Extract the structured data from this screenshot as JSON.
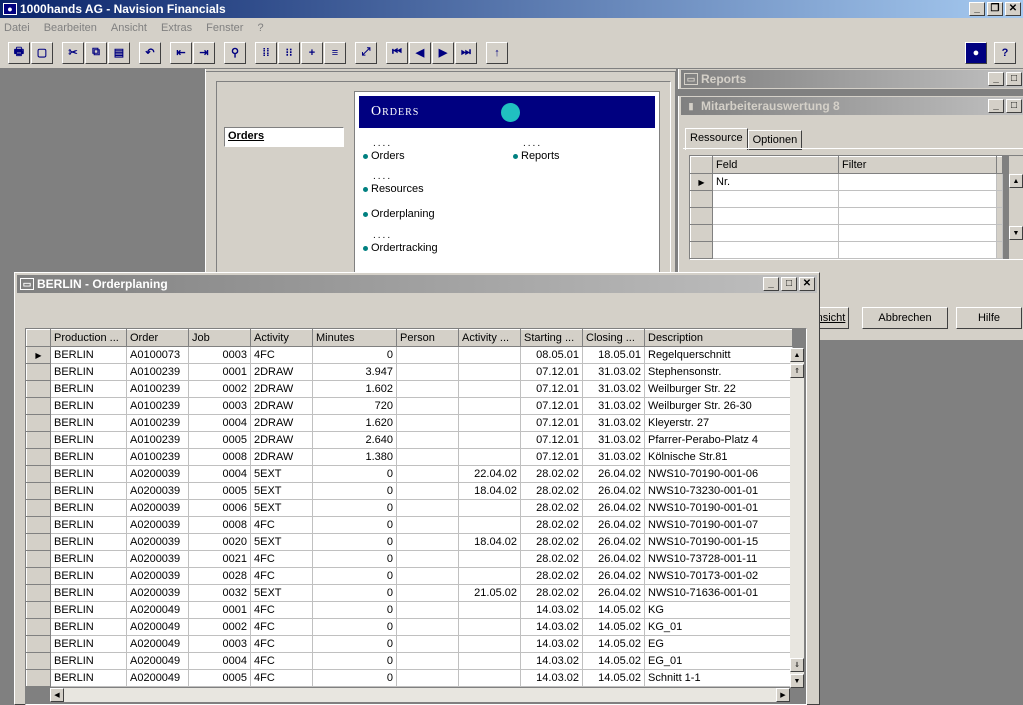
{
  "app": {
    "title": "1000hands AG - Navision Financials"
  },
  "menu": [
    "Datei",
    "Bearbeiten",
    "Ansicht",
    "Extras",
    "Fenster",
    "?"
  ],
  "toolbar": {
    "icons": [
      "print-icon",
      "print-preview-icon",
      "cut-icon",
      "copy-icon",
      "paste-icon",
      "undo-icon",
      "indent-left-icon",
      "indent-right-icon",
      "find-icon",
      "list-view-icon",
      "card-view-icon",
      "insert-icon",
      "filter-icon",
      "zoom-icon",
      "first-record-icon",
      "previous-record-icon",
      "next-record-icon",
      "last-record-icon",
      "up-icon",
      "navigator-icon",
      "help-icon"
    ]
  },
  "navigator": {
    "tab": "Orders",
    "menu_title": "Orders",
    "items": [
      {
        "label": "Orders"
      },
      {
        "label": "Reports"
      },
      {
        "label": "Resources"
      },
      {
        "label": "Orderplaning"
      },
      {
        "label": "Ordertracking"
      }
    ],
    "dots": "...."
  },
  "reports": {
    "title": "Reports"
  },
  "mitarbeiter": {
    "title": "Mitarbeiterauswertung 8",
    "tabs": [
      "Ressource",
      "Optionen"
    ],
    "columns": [
      "Feld",
      "Filter"
    ],
    "rows": [
      [
        "Nr.",
        ""
      ],
      [
        "",
        ""
      ],
      [
        "",
        ""
      ],
      [
        "",
        ""
      ],
      [
        "",
        ""
      ]
    ],
    "buttons": {
      "view": "Ansicht",
      "view_partial": "nsicht",
      "cancel": "Abbrechen",
      "help": "Hilfe"
    }
  },
  "orderplaning": {
    "title": "BERLIN - Orderplaning",
    "columns": [
      "Production ...",
      "Order",
      "Job",
      "Activity",
      "Minutes",
      "Person",
      "Activity ...",
      "Starting ...",
      "Closing ...",
      "Description"
    ],
    "rows": [
      [
        "BERLIN",
        "A0100073",
        "0003",
        "4FC",
        "0",
        "",
        "",
        "08.05.01",
        "18.05.01",
        "Regelquerschnitt"
      ],
      [
        "BERLIN",
        "A0100239",
        "0001",
        "2DRAW",
        "3.947",
        "",
        "",
        "07.12.01",
        "31.03.02",
        "Stephensonstr."
      ],
      [
        "BERLIN",
        "A0100239",
        "0002",
        "2DRAW",
        "1.602",
        "",
        "",
        "07.12.01",
        "31.03.02",
        "Weilburger Str. 22"
      ],
      [
        "BERLIN",
        "A0100239",
        "0003",
        "2DRAW",
        "720",
        "",
        "",
        "07.12.01",
        "31.03.02",
        "Weilburger Str. 26-30"
      ],
      [
        "BERLIN",
        "A0100239",
        "0004",
        "2DRAW",
        "1.620",
        "",
        "",
        "07.12.01",
        "31.03.02",
        "Kleyerstr. 27"
      ],
      [
        "BERLIN",
        "A0100239",
        "0005",
        "2DRAW",
        "2.640",
        "",
        "",
        "07.12.01",
        "31.03.02",
        "Pfarrer-Perabo-Platz 4"
      ],
      [
        "BERLIN",
        "A0100239",
        "0008",
        "2DRAW",
        "1.380",
        "",
        "",
        "07.12.01",
        "31.03.02",
        "Kölnische Str.81"
      ],
      [
        "BERLIN",
        "A0200039",
        "0004",
        "5EXT",
        "0",
        "",
        "22.04.02",
        "28.02.02",
        "26.04.02",
        "NWS10-70190-001-06"
      ],
      [
        "BERLIN",
        "A0200039",
        "0005",
        "5EXT",
        "0",
        "",
        "18.04.02",
        "28.02.02",
        "26.04.02",
        "NWS10-73230-001-01"
      ],
      [
        "BERLIN",
        "A0200039",
        "0006",
        "5EXT",
        "0",
        "",
        "",
        "28.02.02",
        "26.04.02",
        "NWS10-70190-001-01"
      ],
      [
        "BERLIN",
        "A0200039",
        "0008",
        "4FC",
        "0",
        "",
        "",
        "28.02.02",
        "26.04.02",
        "NWS10-70190-001-07"
      ],
      [
        "BERLIN",
        "A0200039",
        "0020",
        "5EXT",
        "0",
        "",
        "18.04.02",
        "28.02.02",
        "26.04.02",
        "NWS10-70190-001-15"
      ],
      [
        "BERLIN",
        "A0200039",
        "0021",
        "4FC",
        "0",
        "",
        "",
        "28.02.02",
        "26.04.02",
        "NWS10-73728-001-11"
      ],
      [
        "BERLIN",
        "A0200039",
        "0028",
        "4FC",
        "0",
        "",
        "",
        "28.02.02",
        "26.04.02",
        "NWS10-70173-001-02"
      ],
      [
        "BERLIN",
        "A0200039",
        "0032",
        "5EXT",
        "0",
        "",
        "21.05.02",
        "28.02.02",
        "26.04.02",
        "NWS10-71636-001-01"
      ],
      [
        "BERLIN",
        "A0200049",
        "0001",
        "4FC",
        "0",
        "",
        "",
        "14.03.02",
        "14.05.02",
        "KG"
      ],
      [
        "BERLIN",
        "A0200049",
        "0002",
        "4FC",
        "0",
        "",
        "",
        "14.03.02",
        "14.05.02",
        "KG_01"
      ],
      [
        "BERLIN",
        "A0200049",
        "0003",
        "4FC",
        "0",
        "",
        "",
        "14.03.02",
        "14.05.02",
        "EG"
      ],
      [
        "BERLIN",
        "A0200049",
        "0004",
        "4FC",
        "0",
        "",
        "",
        "14.03.02",
        "14.05.02",
        "EG_01"
      ],
      [
        "BERLIN",
        "A0200049",
        "0005",
        "4FC",
        "0",
        "",
        "",
        "14.03.02",
        "14.05.02",
        "Schnitt 1-1"
      ]
    ]
  },
  "colors": {
    "titlebar_active": "#0a246a",
    "titlebar_inactive": "#808080",
    "accent_teal": "#008080",
    "banner": "#000080",
    "desktop": "#808080",
    "face": "#d4d0c8"
  }
}
